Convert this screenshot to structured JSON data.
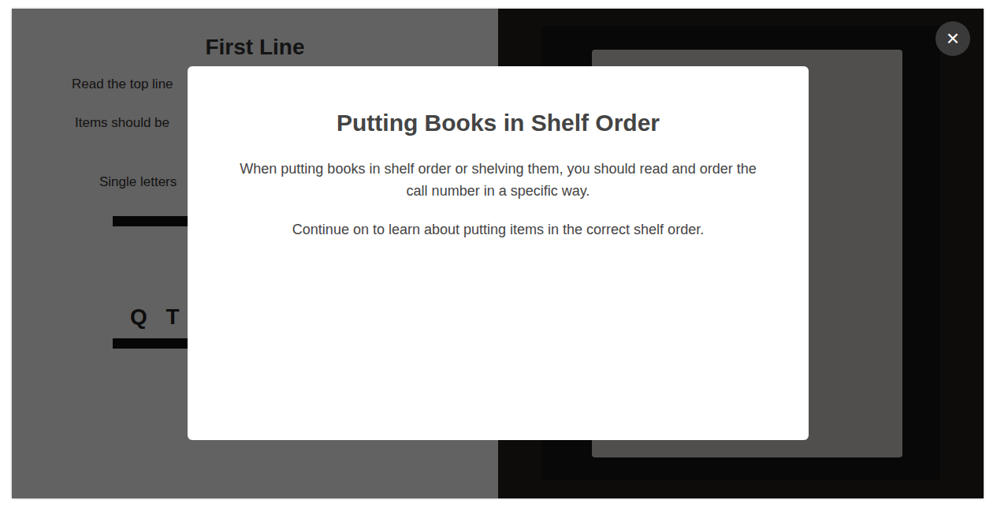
{
  "lesson": {
    "heading": "First Line",
    "lines": [
      "Read the top line",
      "Items should be",
      "Single letters"
    ],
    "call_number": "Q T"
  },
  "modal": {
    "title": "Putting Books in Shelf Order",
    "paragraphs": [
      "When putting books in shelf order or shelving them, you should read and order the call number in a specific way.",
      "Continue on to learn about putting items in the correct shelf order."
    ]
  },
  "close_button": {
    "label": "×"
  }
}
